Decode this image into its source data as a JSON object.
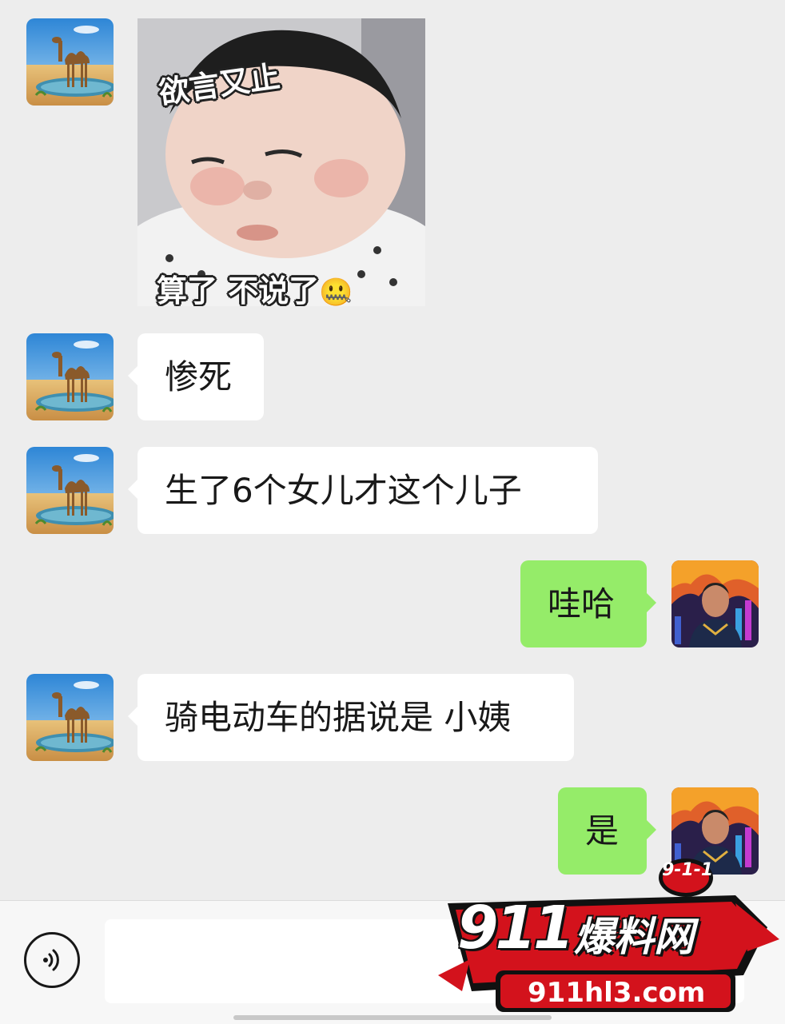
{
  "chat": {
    "messages": [
      {
        "sender": "contact",
        "type": "sticker",
        "sticker_top_text": "欲言又止",
        "sticker_bottom_text": "算了 不说了",
        "sticker_emoji": "🤐"
      },
      {
        "sender": "contact",
        "type": "text",
        "text": "惨死"
      },
      {
        "sender": "contact",
        "type": "text",
        "text": "生了6个女儿才这个儿子"
      },
      {
        "sender": "self",
        "type": "text",
        "text": "哇哈"
      },
      {
        "sender": "contact",
        "type": "text",
        "text": "骑电动车的据说是 小姨"
      },
      {
        "sender": "self",
        "type": "text",
        "text": "是"
      }
    ]
  },
  "input_bar": {
    "voice_icon": "voice-icon",
    "value": ""
  },
  "watermark": {
    "badge": "9-1-1",
    "number": "911",
    "name": "爆料网",
    "url": "911hl3.com"
  },
  "colors": {
    "background": "#ededed",
    "incoming_bubble": "#ffffff",
    "outgoing_bubble": "#95ec69",
    "watermark_red": "#d3121c"
  }
}
